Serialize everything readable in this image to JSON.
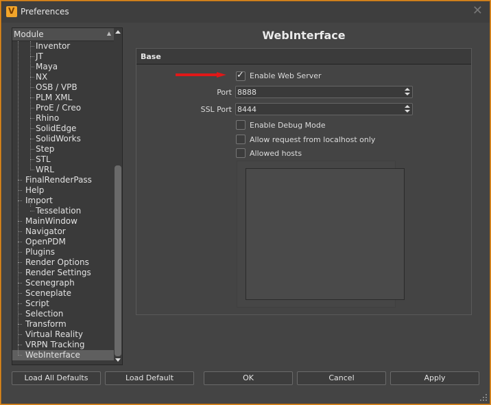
{
  "window": {
    "title": "Preferences",
    "close_glyph": "✕"
  },
  "tree": {
    "header": "Module",
    "items": [
      {
        "label": "Inventor",
        "level": 2
      },
      {
        "label": "JT",
        "level": 2
      },
      {
        "label": "Maya",
        "level": 2
      },
      {
        "label": "NX",
        "level": 2
      },
      {
        "label": "OSB / VPB",
        "level": 2
      },
      {
        "label": "PLM XML",
        "level": 2
      },
      {
        "label": "ProE / Creo",
        "level": 2
      },
      {
        "label": "Rhino",
        "level": 2
      },
      {
        "label": "SolidEdge",
        "level": 2
      },
      {
        "label": "SolidWorks",
        "level": 2
      },
      {
        "label": "Step",
        "level": 2
      },
      {
        "label": "STL",
        "level": 2
      },
      {
        "label": "WRL",
        "level": 2
      },
      {
        "label": "FinalRenderPass",
        "level": 1
      },
      {
        "label": "Help",
        "level": 1
      },
      {
        "label": "Import",
        "level": 1
      },
      {
        "label": "Tesselation",
        "level": 2
      },
      {
        "label": "MainWindow",
        "level": 1
      },
      {
        "label": "Navigator",
        "level": 1
      },
      {
        "label": "OpenPDM",
        "level": 1
      },
      {
        "label": "Plugins",
        "level": 1
      },
      {
        "label": "Render Options",
        "level": 1
      },
      {
        "label": "Render Settings",
        "level": 1
      },
      {
        "label": "Scenegraph",
        "level": 1
      },
      {
        "label": "Sceneplate",
        "level": 1
      },
      {
        "label": "Script",
        "level": 1
      },
      {
        "label": "Selection",
        "level": 1
      },
      {
        "label": "Transform",
        "level": 1
      },
      {
        "label": "Virtual Reality",
        "level": 1
      },
      {
        "label": "VRPN Tracking",
        "level": 1
      },
      {
        "label": "WebInterface",
        "level": 1,
        "selected": true
      }
    ]
  },
  "page": {
    "heading": "WebInterface",
    "group_title": "Base",
    "enable_web_server": {
      "label": "Enable Web Server",
      "checked": true
    },
    "port": {
      "label": "Port",
      "value": "8888"
    },
    "ssl_port": {
      "label": "SSL Port",
      "value": "8444"
    },
    "debug_mode": {
      "label": "Enable Debug Mode",
      "checked": false
    },
    "localhost_only": {
      "label": "Allow request from localhost only",
      "checked": false
    },
    "allowed_hosts": {
      "label": "Allowed hosts",
      "checked": false
    }
  },
  "buttons": {
    "load_all_defaults": "Load All Defaults",
    "load_default": "Load Default",
    "ok": "OK",
    "cancel": "Cancel",
    "apply": "Apply"
  },
  "colors": {
    "accent_border": "#e08a1e",
    "annotation_arrow": "#e01818",
    "selected_row": "#5f5f5f"
  }
}
